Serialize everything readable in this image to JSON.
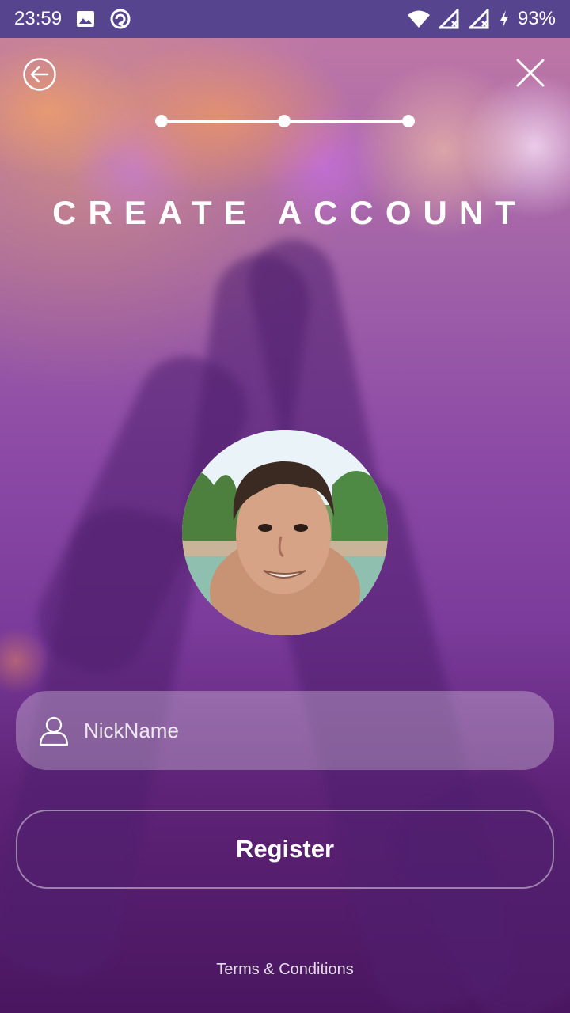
{
  "status_bar": {
    "time": "23:59",
    "battery": "93%",
    "icons": [
      "gallery-icon",
      "sync-icon",
      "wifi-icon",
      "signal-icon",
      "signal-icon",
      "charging-icon"
    ]
  },
  "nav": {
    "back_icon": "arrow-left-circle-icon",
    "close_icon": "close-icon"
  },
  "progress": {
    "steps": 3,
    "current_step": 3
  },
  "title": "CREATE ACCOUNT",
  "profile": {
    "avatar_icon": "profile-photo"
  },
  "form": {
    "nickname_placeholder": "NickName",
    "nickname_value": "",
    "user_icon": "user-icon",
    "register_label": "Register"
  },
  "footer": {
    "terms_label": "Terms & Conditions"
  },
  "colors": {
    "status_bar": "#56448f",
    "accent": "#ffffff",
    "background_bottom": "#4a1660"
  }
}
